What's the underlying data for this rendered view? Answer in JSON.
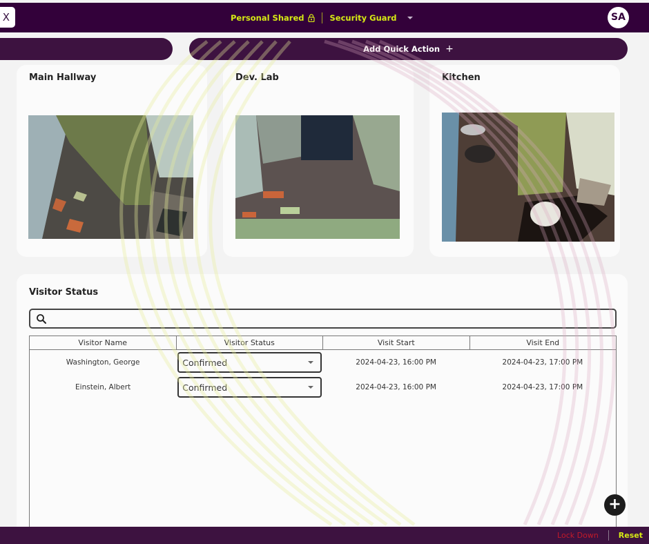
{
  "topbar": {
    "close_label": "X",
    "workspace_label": "Personal Shared",
    "workspace_icon": "lock-icon",
    "role_label": "Security Guard",
    "role_icon": "caret-down-icon",
    "avatar_initials": "SA"
  },
  "quick_actions": {
    "add_label": "Add Quick Action",
    "add_icon": "+"
  },
  "cameras": [
    {
      "title": "Main Hallway"
    },
    {
      "title": "Dev. Lab"
    },
    {
      "title": "Kitchen"
    }
  ],
  "visitors": {
    "title": "Visitor Status",
    "search_placeholder": "",
    "search_value": "",
    "columns": [
      "Visitor Name",
      "Visitor Status",
      "Visit Start",
      "Visit End"
    ],
    "rows": [
      {
        "name": "Washington, George",
        "status": "Confirmed",
        "start": "2024-04-23, 16:00 PM",
        "end": "2024-04-23, 17:00 PM"
      },
      {
        "name": "Einstein, Albert",
        "status": "Confirmed",
        "start": "2024-04-23, 16:00 PM",
        "end": "2024-04-23, 17:00 PM"
      }
    ],
    "add_icon": "+"
  },
  "bottombar": {
    "lockdown_label": "Lock Down",
    "reset_label": "Reset"
  },
  "colors": {
    "brand_dark": "#33013a",
    "accent_yellow": "#d6ea14",
    "danger": "#c21a2a"
  }
}
